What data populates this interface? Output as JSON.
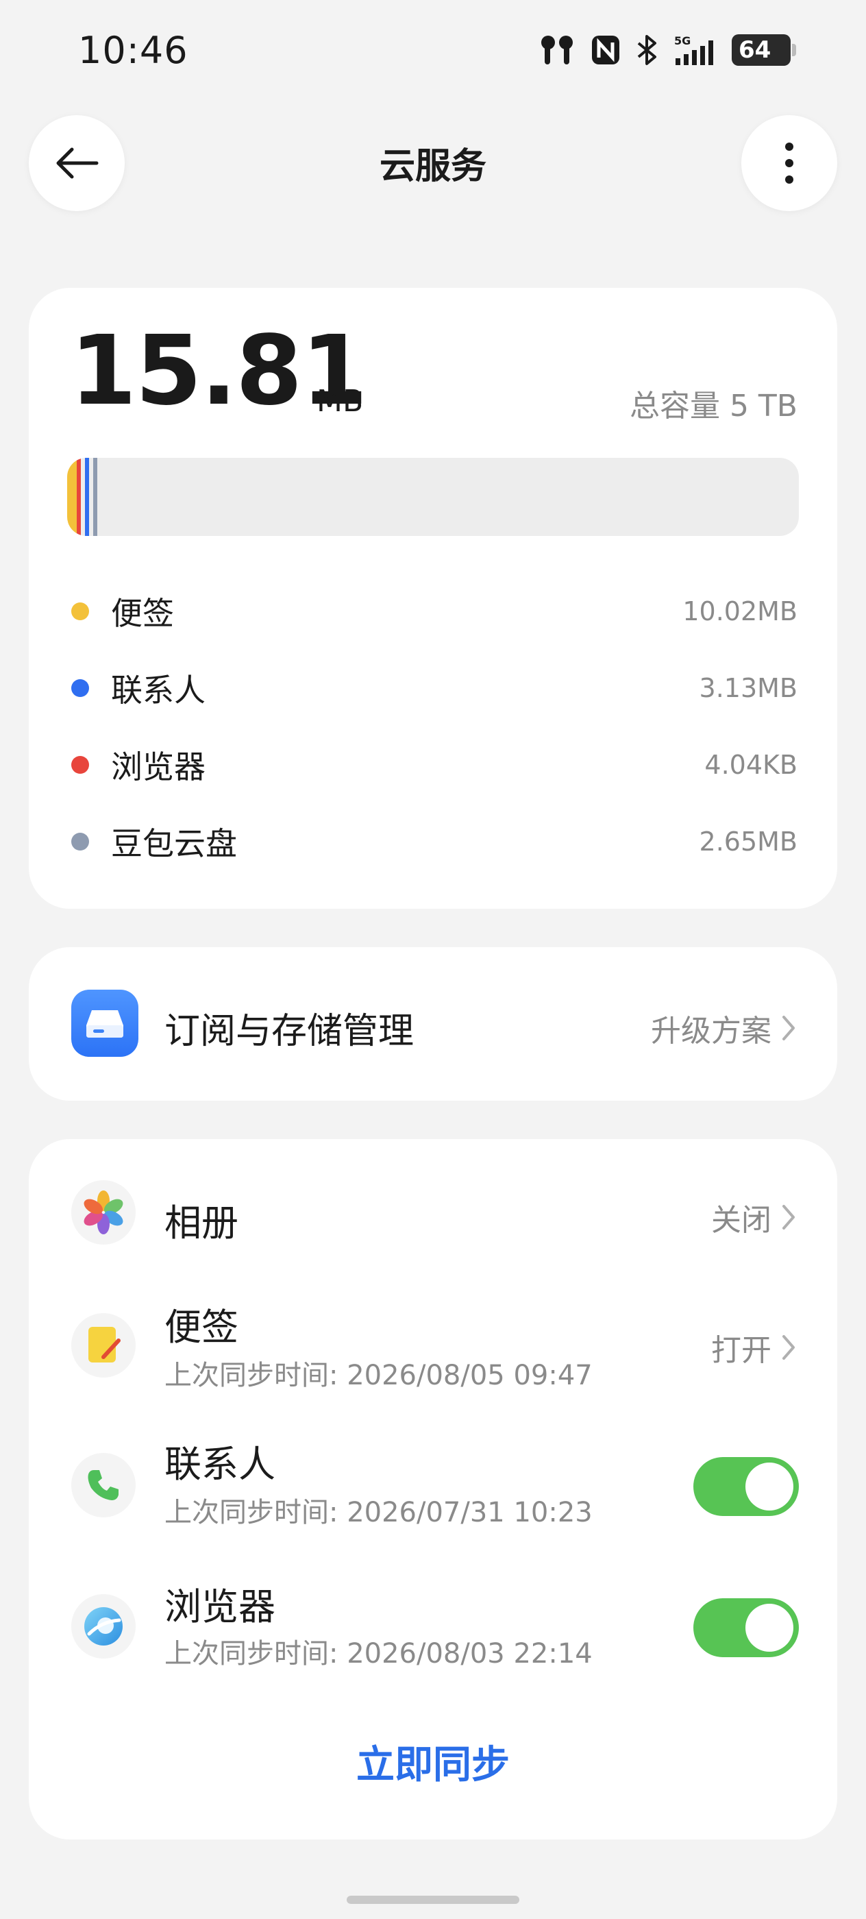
{
  "status_bar": {
    "time": "10:46",
    "network": "5G",
    "battery": "64",
    "icons": [
      "earbuds-icon",
      "nfc-icon",
      "bluetooth-icon",
      "signal-icon",
      "battery-icon"
    ]
  },
  "header": {
    "title": "云服务",
    "back_icon": "arrow-left-icon",
    "more_icon": "more-vertical-icon"
  },
  "storage": {
    "used_value": "15.81",
    "used_unit": "MB",
    "total_capacity": "总容量 5 TB",
    "items": [
      {
        "name": "便签",
        "size": "10.02MB",
        "color": "#f3c13a"
      },
      {
        "name": "联系人",
        "size": "3.13MB",
        "color": "#2f6ef0"
      },
      {
        "name": "浏览器",
        "size": "4.04KB",
        "color": "#e8453c"
      },
      {
        "name": "豆包云盘",
        "size": "2.65MB",
        "color": "#8e9bb0"
      }
    ]
  },
  "subscription": {
    "title": "订阅与存储管理",
    "action": "升级方案",
    "icon": "storage-drive-icon"
  },
  "sync": {
    "items": [
      {
        "name": "相册",
        "status": "关闭",
        "icon": "photos-icon"
      },
      {
        "name": "便签",
        "last_sync": "上次同步时间: 2026/08/05 09:47",
        "status": "打开",
        "icon": "notes-icon"
      },
      {
        "name": "联系人",
        "last_sync": "上次同步时间: 2026/07/31 10:23",
        "toggle_on": true,
        "icon": "phone-icon"
      },
      {
        "name": "浏览器",
        "last_sync": "上次同步时间: 2026/08/03 22:14",
        "toggle_on": true,
        "icon": "browser-icon"
      }
    ],
    "sync_now": "立即同步"
  },
  "colors": {
    "accent": "#2a6ee8",
    "toggle_on": "#57c454",
    "subscription_icon": "#3b82f6"
  }
}
